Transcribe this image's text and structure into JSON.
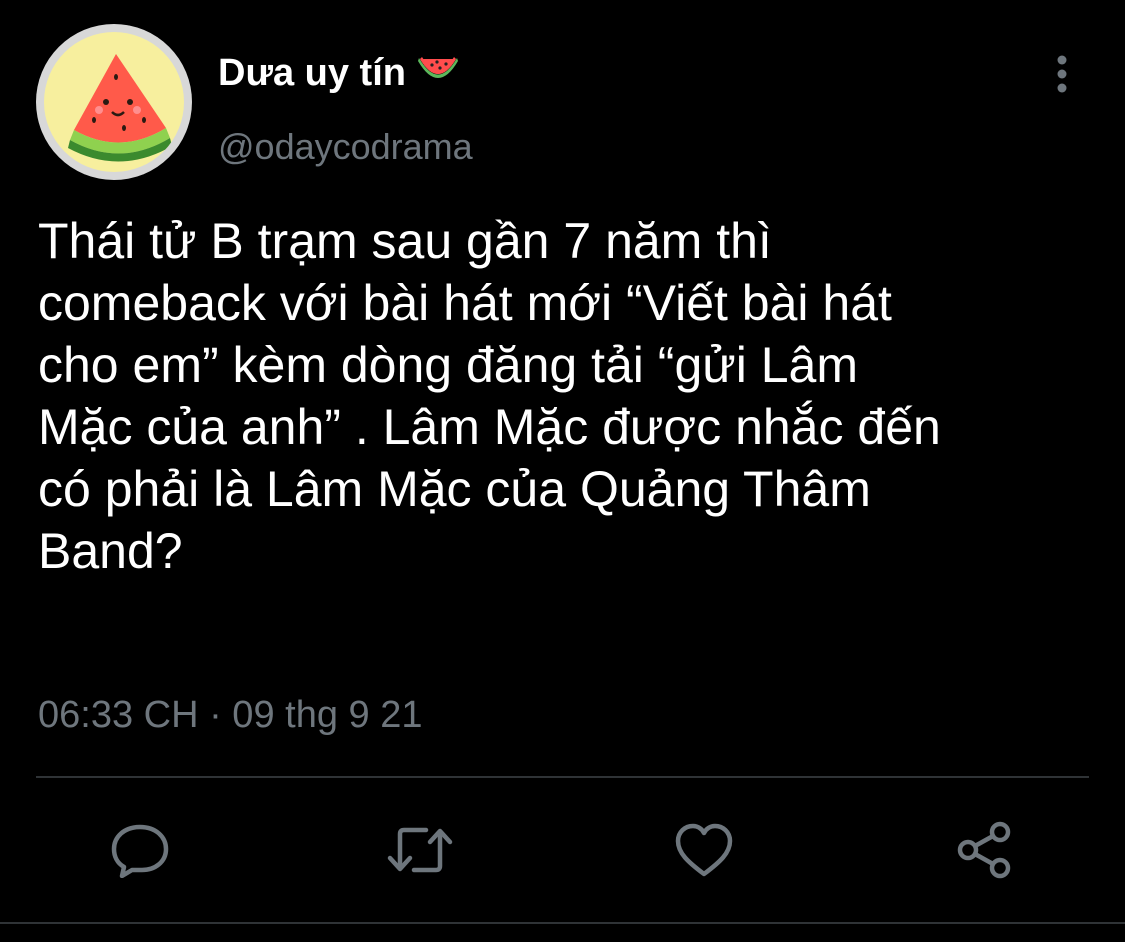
{
  "tweet": {
    "display_name": "Dưa uy tín",
    "handle": "@odaycodrama",
    "text": "Thái tử B trạm sau gần 7 năm thì\ncomeback với bài hát mới “Viết bài hát\ncho em” kèm dòng đăng tải “gửi Lâm\nMặc của anh” . Lâm Mặc được nhắc đến\ncó phải là Lâm Mặc của Quảng Thâm\nBand?",
    "timestamp": "06:33 CH · 09 thg 9 21"
  },
  "icons": {
    "avatar": "watermelon-avatar",
    "name_emoji": "watermelon-icon",
    "more": "more-vertical-icon",
    "reply": "reply-icon",
    "retweet": "retweet-icon",
    "like": "like-icon",
    "share": "share-icon"
  },
  "colors": {
    "background": "#000000",
    "text_primary": "#ffffff",
    "text_secondary": "#6e767d",
    "divider": "#2f3336"
  }
}
